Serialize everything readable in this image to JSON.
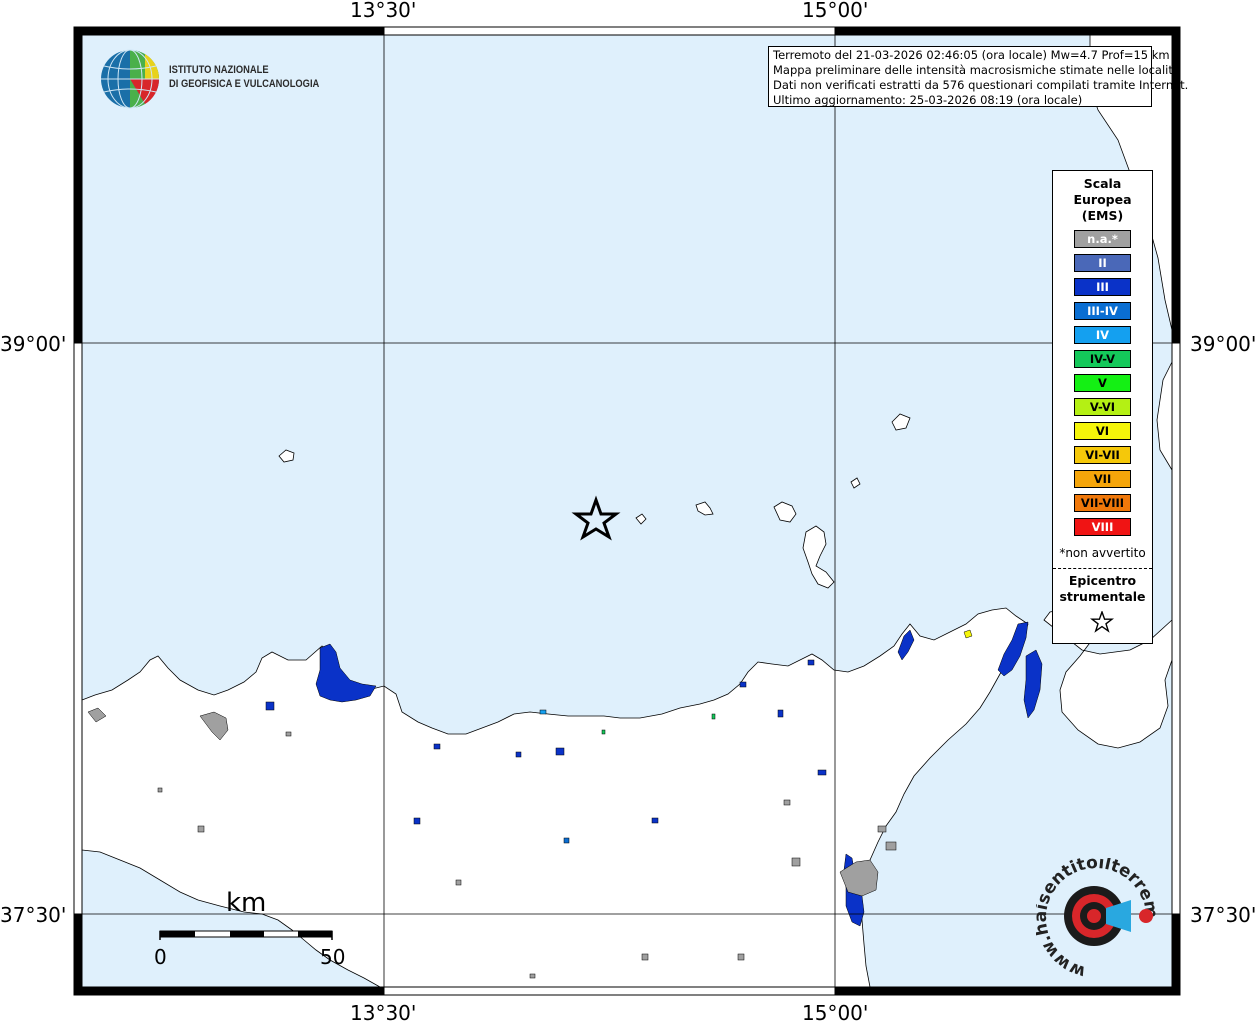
{
  "info": {
    "line1": "Terremoto del 21-03-2026 02:46:05 (ora locale) Mw=4.7 Prof=15 km",
    "line2": "Mappa preliminare delle intensità macrosismiche stimate nelle località",
    "line3": "Dati non verificati estratti da 576 questionari compilati tramite Internet.",
    "line4": "Ultimo aggiornamento: 25-03-2026 08:19 (ora locale)"
  },
  "axes": {
    "top_ticks": [
      "13°30'",
      "15°00'"
    ],
    "bottom_ticks": [
      "13°30'",
      "15°00'"
    ],
    "left_ticks": [
      "39°00'",
      "37°30'"
    ],
    "right_ticks": [
      "39°00'",
      "37°30'"
    ]
  },
  "ingv": {
    "line1": "ISTITUTO NAZIONALE",
    "line2": "DI GEOFISICA E VULCANOLOGIA"
  },
  "legend": {
    "title1": "Scala",
    "title2": "Europea",
    "title3": "(EMS)",
    "items": [
      {
        "label": "n.a.*",
        "color": "#a0a0a0",
        "text_color": "#ffffff"
      },
      {
        "label": "II",
        "color": "#4a68b8",
        "text_color": "#ffffff"
      },
      {
        "label": "III",
        "color": "#0a32c8",
        "text_color": "#ffffff"
      },
      {
        "label": "III-IV",
        "color": "#0a6ed2",
        "text_color": "#ffffff"
      },
      {
        "label": "IV",
        "color": "#14a0f0",
        "text_color": "#ffffff"
      },
      {
        "label": "IV-V",
        "color": "#14c85a",
        "text_color": "#000000"
      },
      {
        "label": "V",
        "color": "#14f014",
        "text_color": "#000000"
      },
      {
        "label": "V-VI",
        "color": "#b4f014",
        "text_color": "#000000"
      },
      {
        "label": "VI",
        "color": "#f5f50a",
        "text_color": "#000000"
      },
      {
        "label": "VI-VII",
        "color": "#f5c80a",
        "text_color": "#000000"
      },
      {
        "label": "VII",
        "color": "#f5a50a",
        "text_color": "#000000"
      },
      {
        "label": "VII-VIII",
        "color": "#f0780a",
        "text_color": "#000000"
      },
      {
        "label": "VIII",
        "color": "#f01414",
        "text_color": "#ffffff"
      }
    ],
    "note": "*non avvertito",
    "epicentre1": "Epicentro",
    "epicentre2": "strumentale"
  },
  "scale": {
    "unit": "km",
    "start": "0",
    "end": "50"
  },
  "hsit": {
    "text": "www.haisentitoilterremoto.it"
  },
  "colors": {
    "sea": "#dff0fc",
    "land": "#ffffff",
    "intensity_iii": "#0a32c8",
    "na": "#a0a0a0"
  }
}
